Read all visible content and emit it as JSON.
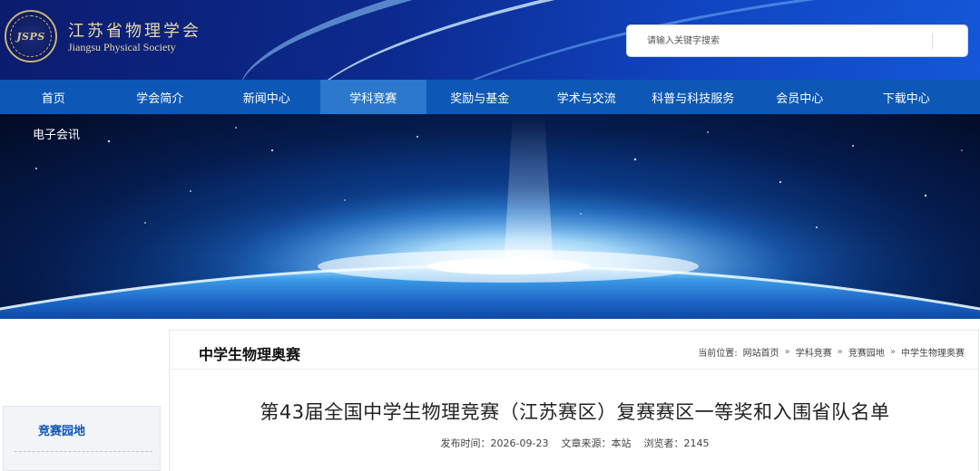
{
  "header": {
    "logo_abbr": "JSPS",
    "org_name": "江苏省物理学会",
    "org_name_en": "Jiangsu Physical Society",
    "search_placeholder": "请输入关键字搜索"
  },
  "nav": {
    "items": [
      {
        "label": "首页"
      },
      {
        "label": "学会简介"
      },
      {
        "label": "新闻中心"
      },
      {
        "label": "学科竞赛"
      },
      {
        "label": "奖励与基金"
      },
      {
        "label": "学术与交流"
      },
      {
        "label": "科普与科技服务"
      },
      {
        "label": "会员中心"
      },
      {
        "label": "下载中心"
      }
    ],
    "active_index": 3,
    "sub_item": "电子会讯"
  },
  "sidebar": {
    "title": "竞赛园地"
  },
  "main": {
    "section_title": "中学生物理奥赛",
    "breadcrumb": {
      "prefix": "当前位置:",
      "items": [
        "网站首页",
        "学科竞赛",
        "竞赛园地",
        "中学生物理奥赛"
      ],
      "separator": "»"
    },
    "article_title": "第43届全国中学生物理竞赛（江苏赛区）复赛赛区一等奖和入围省队名单",
    "meta": {
      "date_label": "发布时间：2026-09-23",
      "source_label": "文章来源：本站",
      "views_label": "浏览者：2145"
    }
  },
  "colors": {
    "nav_bg": "#0d58b6",
    "nav_active": "#2b78cc",
    "accent_text": "#0d58b6"
  }
}
